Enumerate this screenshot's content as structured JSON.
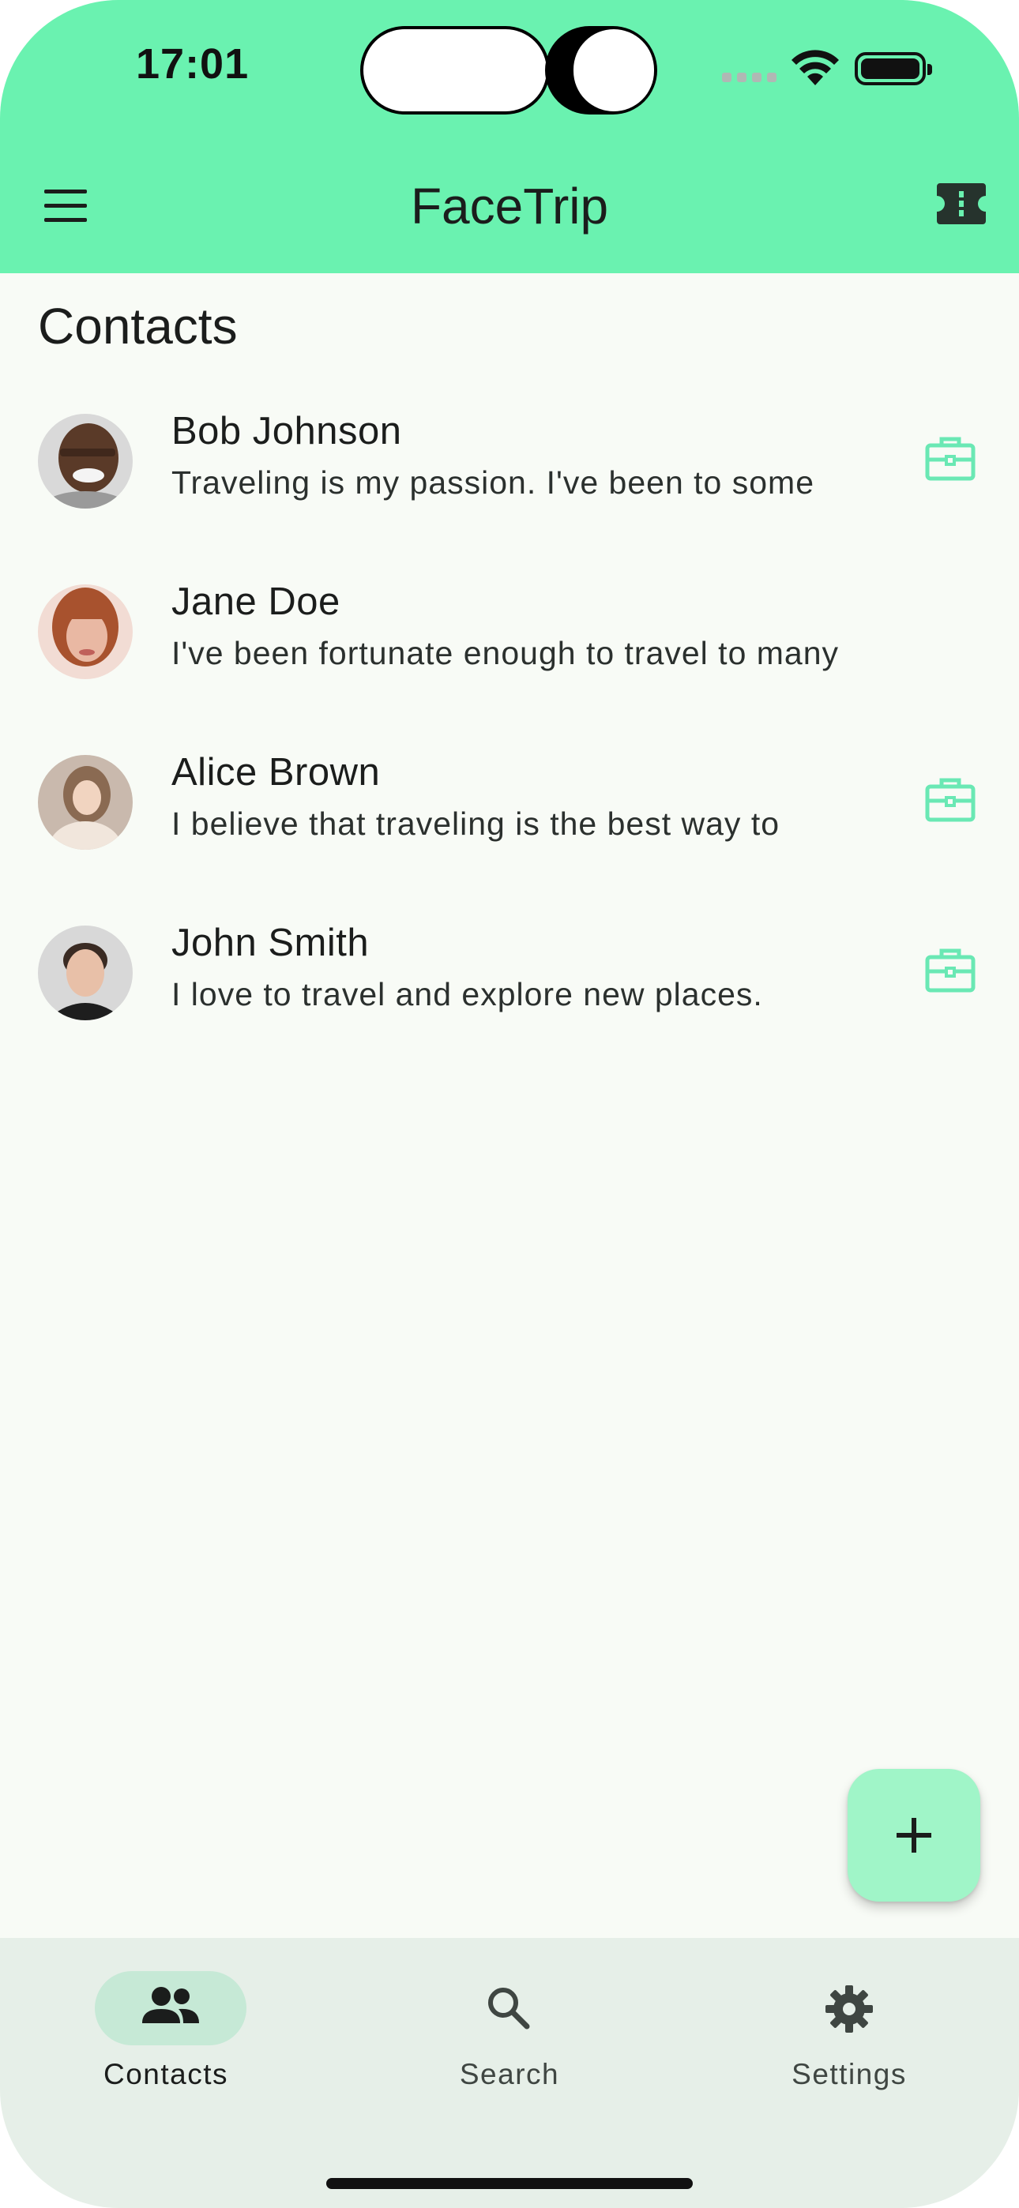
{
  "status_bar": {
    "time": "17:01"
  },
  "app_bar": {
    "title": "FaceTrip",
    "menu_icon": "hamburger-menu-icon",
    "action_icon": "ticket-icon"
  },
  "page": {
    "section_title": "Contacts"
  },
  "contacts": [
    {
      "name": "Bob Johnson",
      "bio": "Traveling is my passion. I've been to some",
      "has_trip": true,
      "avatar_colors": [
        "#5a3a28",
        "#2e1d14",
        "#c8c8c8"
      ]
    },
    {
      "name": "Jane Doe",
      "bio": "I've been fortunate enough to travel to many",
      "has_trip": false,
      "avatar_colors": [
        "#f2dcd4",
        "#a8522e",
        "#e9b8a3"
      ]
    },
    {
      "name": "Alice Brown",
      "bio": "I believe that traveling is the best way to",
      "has_trip": true,
      "avatar_colors": [
        "#c9b9ad",
        "#8a6a52",
        "#f1e6dc"
      ]
    },
    {
      "name": "John Smith",
      "bio": "I love to travel and explore new places.",
      "has_trip": true,
      "avatar_colors": [
        "#d8d8d8",
        "#3a2b23",
        "#e8c0a8"
      ]
    }
  ],
  "fab": {
    "icon": "plus-icon"
  },
  "bottom_nav": {
    "items": [
      {
        "label": "Contacts",
        "icon": "people-icon",
        "active": true
      },
      {
        "label": "Search",
        "icon": "search-icon",
        "active": false
      },
      {
        "label": "Settings",
        "icon": "gear-icon",
        "active": false
      }
    ]
  },
  "colors": {
    "accent": "#6af2b0",
    "fab": "#a0f5c8",
    "trip_icon": "#6ae8b4",
    "background": "#f8fbf6",
    "nav_background": "#e6efe8",
    "nav_active_pill": "#c6e9d6"
  }
}
